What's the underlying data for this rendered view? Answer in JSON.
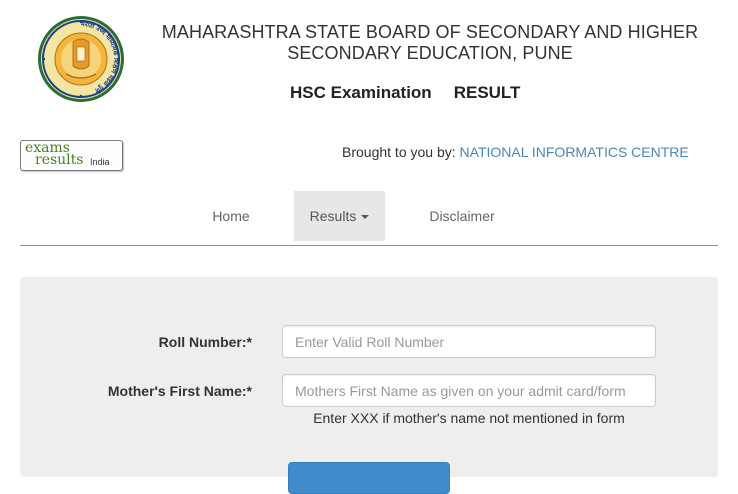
{
  "header": {
    "seal_text": "मराठी उच्च माध्यमिक शिक्षण मंडळ पुणे",
    "board_title": "MAHARASHTRA STATE BOARD OF SECONDARY AND HIGHER SECONDARY EDUCATION, PUNE",
    "exam_name": "HSC Examination",
    "result_label": "RESULT"
  },
  "partner": {
    "logo_exams": "exams",
    "logo_results": "results",
    "logo_india": "India",
    "brought_prefix": "Brought to you by: ",
    "brought_org": "NATIONAL INFORMATICS CENTRE"
  },
  "nav": {
    "home": "Home",
    "results": "Results",
    "disclaimer": "Disclaimer"
  },
  "form": {
    "roll_label": "Roll Number:*",
    "roll_placeholder": "Enter Valid Roll Number",
    "roll_value": "",
    "mother_label": "Mother's First Name:*",
    "mother_placeholder": "Mothers First Name as given on your admit card/form",
    "mother_value": "",
    "mother_hint": "Enter XXX if mother's name not mentioned in form"
  },
  "colors": {
    "accent": "#428bca",
    "link": "#4a86b8",
    "nav_active_bg": "#e7e7e7",
    "rule": "#5aa9a6",
    "panel_bg": "#eeeeee"
  },
  "icons": {
    "seal": "board-seal-icon",
    "caret": "caret-down-icon"
  }
}
